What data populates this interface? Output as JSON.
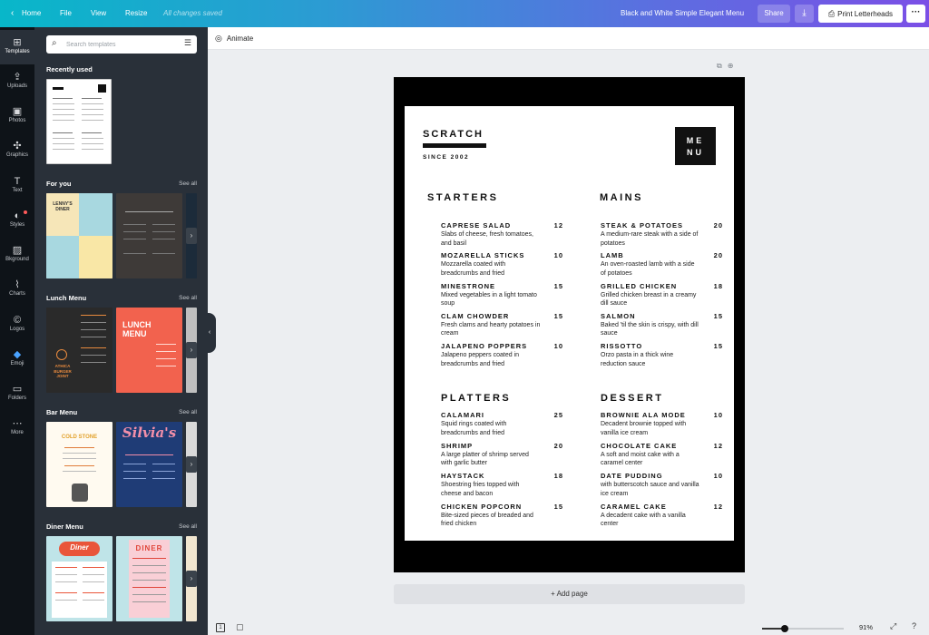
{
  "topbar": {
    "back_icon": "chevron-left-icon",
    "home": "Home",
    "file": "File",
    "view": "View",
    "resize": "Resize",
    "saved_status": "All changes saved",
    "design_title": "Black and White Simple Elegant Menu",
    "share": "Share",
    "download_icon": "download-icon",
    "print": "Print Letterheads",
    "more_icon": "ellipsis-icon"
  },
  "rail": {
    "items": [
      {
        "label": "Templates",
        "icon": "⊞"
      },
      {
        "label": "Uploads",
        "icon": "⇪"
      },
      {
        "label": "Photos",
        "icon": "▣"
      },
      {
        "label": "Graphics",
        "icon": "✣"
      },
      {
        "label": "Text",
        "icon": "T"
      },
      {
        "label": "Styles",
        "icon": "◐"
      },
      {
        "label": "Bkground",
        "icon": "▨"
      },
      {
        "label": "Charts",
        "icon": "⌇"
      },
      {
        "label": "Logos",
        "icon": "©"
      },
      {
        "label": "Emoji",
        "icon": "◆"
      },
      {
        "label": "Folders",
        "icon": "▭"
      },
      {
        "label": "More",
        "icon": "⋯"
      }
    ]
  },
  "panel": {
    "search_placeholder": "Search templates",
    "recently_used": "Recently used",
    "sections": [
      {
        "title": "For you",
        "see_all": "See all"
      },
      {
        "title": "Lunch Menu",
        "see_all": "See all"
      },
      {
        "title": "Bar Menu",
        "see_all": "See all"
      },
      {
        "title": "Diner Menu",
        "see_all": "See all"
      }
    ],
    "thumb_texts": {
      "lenny": "LENNY'S\nDINER",
      "lunch": "LUNCH\nMENU",
      "attica": "ATHICA\nBURGER\nJOINT",
      "cold": "COLD STONE",
      "silvia": "Silvia's",
      "diner1": "Diner",
      "diner2": "DINER"
    }
  },
  "canvas": {
    "animate": "Animate",
    "brand": "SCRATCH",
    "since": "SINCE 2002",
    "menu_box_1": "ME",
    "menu_box_2": "NU",
    "sections": [
      {
        "title": "STARTERS",
        "items": [
          {
            "name": "CAPRESE SALAD",
            "price": "12",
            "desc": "Slabs of cheese, fresh tomatoes, and basil"
          },
          {
            "name": "MOZARELLA STICKS",
            "price": "10",
            "desc": "Mozzarella coated with breadcrumbs and fried"
          },
          {
            "name": "MINESTRONE",
            "price": "15",
            "desc": "Mixed vegetables in a light tomato soup"
          },
          {
            "name": "CLAM CHOWDER",
            "price": "15",
            "desc": "Fresh clams and hearty potatoes in cream"
          },
          {
            "name": "JALAPENO POPPERS",
            "price": "10",
            "desc": "Jalapeno peppers coated in breadcrumbs and fried"
          }
        ]
      },
      {
        "title": "MAINS",
        "items": [
          {
            "name": "STEAK & POTATOES",
            "price": "20",
            "desc": "A medium-rare steak with a side of potatoes"
          },
          {
            "name": "LAMB",
            "price": "20",
            "desc": "An oven-roasted lamb with a side of potatoes"
          },
          {
            "name": "GRILLED CHICKEN",
            "price": "18",
            "desc": "Grilled chicken breast in a creamy dill sauce"
          },
          {
            "name": "SALMON",
            "price": "15",
            "desc": "Baked 'til the skin is crispy, with dill sauce"
          },
          {
            "name": "RISSOTTO",
            "price": "15",
            "desc": "Orzo pasta in a thick wine reduction sauce"
          }
        ]
      },
      {
        "title": "PLATTERS",
        "items": [
          {
            "name": "CALAMARI",
            "price": "25",
            "desc": "Squid rings coated with breadcrumbs and fried"
          },
          {
            "name": "SHRIMP",
            "price": "20",
            "desc": "A large platter of shrimp served with garlic butter"
          },
          {
            "name": "HAYSTACK",
            "price": "18",
            "desc": "Shoestring fries topped with cheese and bacon"
          },
          {
            "name": "CHICKEN POPCORN",
            "price": "15",
            "desc": "Bite-sized pieces of breaded and fried chicken"
          }
        ]
      },
      {
        "title": "DESSERT",
        "items": [
          {
            "name": "BROWNIE ALA MODE",
            "price": "10",
            "desc": "Decadent brownie topped with vanilla ice cream"
          },
          {
            "name": "CHOCOLATE CAKE",
            "price": "12",
            "desc": "A soft and moist cake with a caramel center"
          },
          {
            "name": "DATE PUDDING",
            "price": "10",
            "desc": "with butterscotch sauce and vanilla ice cream"
          },
          {
            "name": "CARAMEL CAKE",
            "price": "12",
            "desc": "A decadent cake with a vanilla center"
          }
        ]
      }
    ],
    "add_page": "+ Add page"
  },
  "footer": {
    "page_count": "1",
    "zoom": "91%",
    "zoom_level": 0.91
  },
  "colors": {
    "accent_gradient_start": "#08b7c9",
    "accent_gradient_end": "#7b4fe6",
    "sidebar": "#293039",
    "rail": "#0e1318"
  }
}
